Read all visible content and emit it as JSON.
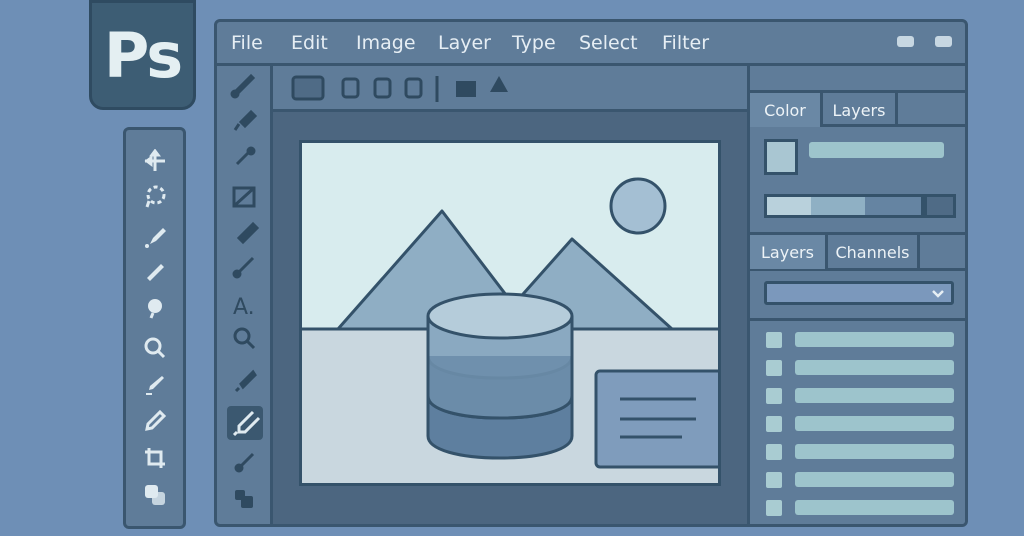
{
  "app": {
    "logo_text": "Ps"
  },
  "menu": [
    "File",
    "Edit",
    "Image",
    "Layer",
    "Type",
    "Select",
    "Filter"
  ],
  "panels": {
    "top_tabs": [
      "Color",
      "Layers"
    ],
    "bottom_tabs": [
      "Layers",
      "Channels"
    ]
  },
  "colors": {
    "background": "#6e8fb6",
    "panel": "#5f7c99",
    "border": "#3a566f",
    "canvas": "#d8ecee",
    "accent": "#9dc4cc"
  }
}
